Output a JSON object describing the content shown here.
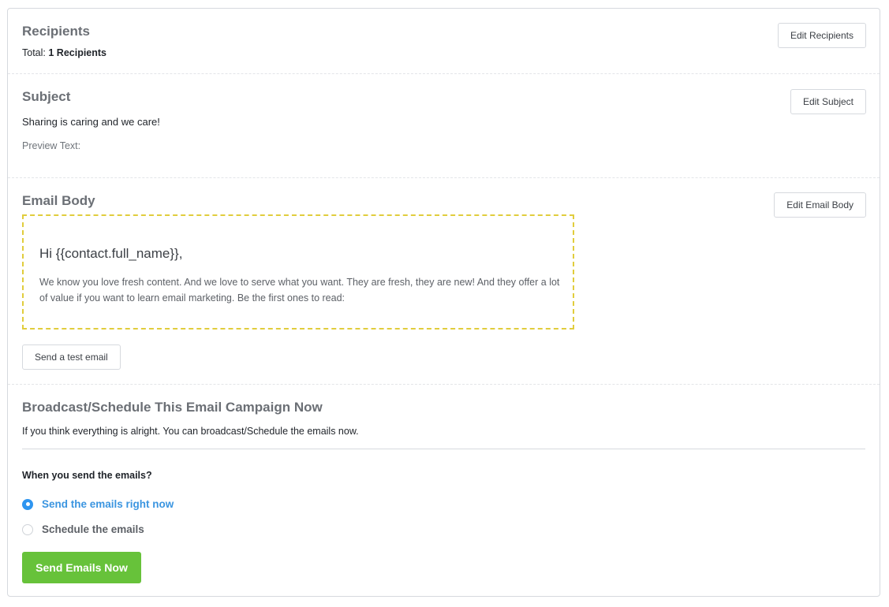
{
  "recipients": {
    "title": "Recipients",
    "total_label": "Total:",
    "total_value": "1 Recipients",
    "edit_button": "Edit Recipients"
  },
  "subject": {
    "title": "Subject",
    "value": "Sharing is caring and we care!",
    "preview_label": "Preview Text:",
    "edit_button": "Edit Subject"
  },
  "email_body": {
    "title": "Email Body",
    "edit_button": "Edit Email Body",
    "greeting": "Hi {{contact.full_name}},",
    "paragraph": "We know you love fresh content. And we love to serve what you want. They are fresh, they are new! And they offer a lot of value if you want to learn email marketing. Be the first ones to read:",
    "test_button": "Send a test email"
  },
  "broadcast": {
    "title": "Broadcast/Schedule This Email Campaign Now",
    "description": "If you think everything is alright. You can broadcast/Schedule the emails now.",
    "question": "When you send the emails?",
    "options": [
      {
        "label": "Send the emails right now",
        "selected": true
      },
      {
        "label": "Schedule the emails",
        "selected": false
      }
    ],
    "send_button": "Send Emails Now"
  },
  "colors": {
    "primary": "#2e95f0",
    "success": "#67c23a",
    "preview_border": "#e1cd3d"
  }
}
